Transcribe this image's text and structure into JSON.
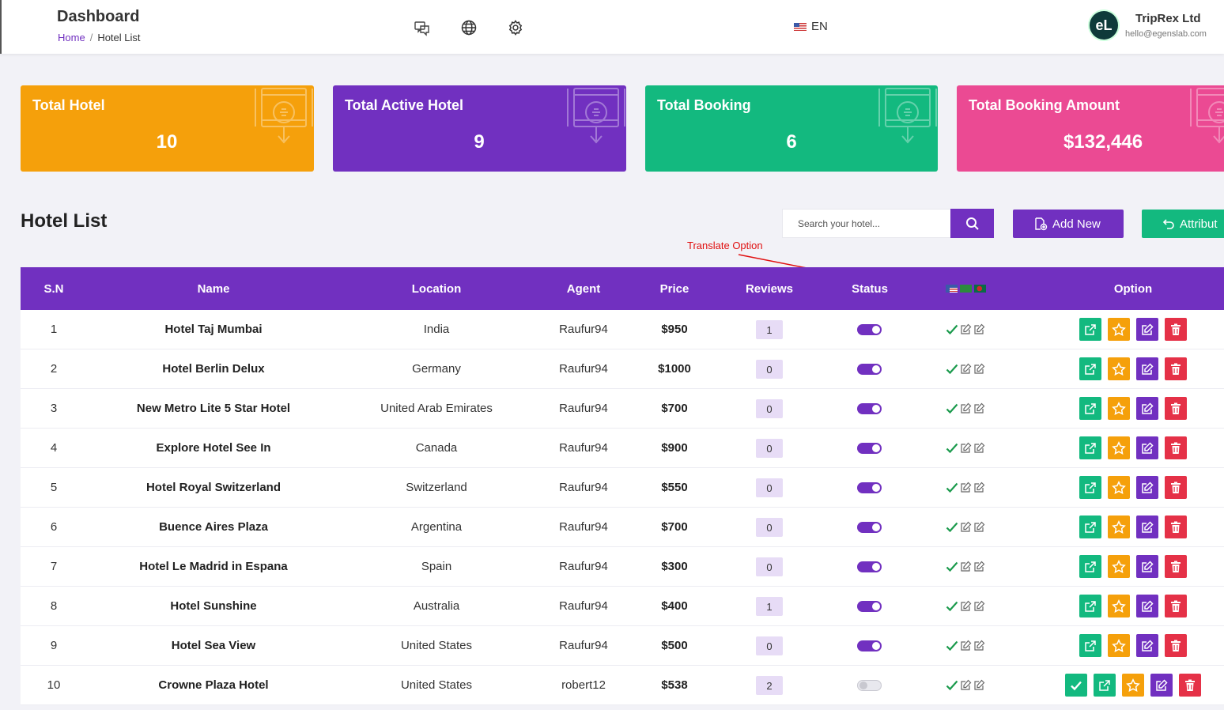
{
  "header": {
    "title": "Dashboard",
    "breadcrumb_home": "Home",
    "breadcrumb_sep": "/",
    "breadcrumb_current": "Hotel List",
    "language": "EN",
    "avatar_initials": "eL",
    "company": "TripRex Ltd",
    "email": "hello@egenslab.com"
  },
  "stats": [
    {
      "label": "Total Hotel",
      "value": "10",
      "color": "#f5a00b"
    },
    {
      "label": "Total Active Hotel",
      "value": "9",
      "color": "#7130c0"
    },
    {
      "label": "Total Booking",
      "value": "6",
      "color": "#13b97f"
    },
    {
      "label": "Total Booking Amount",
      "value": "$132,446",
      "color": "#eb4a93"
    }
  ],
  "list": {
    "title": "Hotel List",
    "search_placeholder": "Search your hotel...",
    "add_label": "Add New",
    "attr_label": "Attribut",
    "annotation": "Translate Option"
  },
  "table": {
    "columns": [
      "S.N",
      "Name",
      "Location",
      "Agent",
      "Price",
      "Reviews",
      "Status",
      "",
      "Option"
    ],
    "rows": [
      {
        "sn": "1",
        "name": "Hotel Taj Mumbai",
        "location": "India",
        "agent": "Raufur94",
        "price": "$950",
        "reviews": "1",
        "active": true,
        "approved": true
      },
      {
        "sn": "2",
        "name": "Hotel Berlin Delux",
        "location": "Germany",
        "agent": "Raufur94",
        "price": "$1000",
        "reviews": "0",
        "active": true,
        "approved": true
      },
      {
        "sn": "3",
        "name": "New Metro Lite 5 Star Hotel",
        "location": "United Arab Emirates",
        "agent": "Raufur94",
        "price": "$700",
        "reviews": "0",
        "active": true,
        "approved": true
      },
      {
        "sn": "4",
        "name": "Explore Hotel See In",
        "location": "Canada",
        "agent": "Raufur94",
        "price": "$900",
        "reviews": "0",
        "active": true,
        "approved": true
      },
      {
        "sn": "5",
        "name": "Hotel Royal Switzerland",
        "location": "Switzerland",
        "agent": "Raufur94",
        "price": "$550",
        "reviews": "0",
        "active": true,
        "approved": true
      },
      {
        "sn": "6",
        "name": "Buence Aires Plaza",
        "location": "Argentina",
        "agent": "Raufur94",
        "price": "$700",
        "reviews": "0",
        "active": true,
        "approved": true
      },
      {
        "sn": "7",
        "name": "Hotel Le Madrid in Espana",
        "location": "Spain",
        "agent": "Raufur94",
        "price": "$300",
        "reviews": "0",
        "active": true,
        "approved": true
      },
      {
        "sn": "8",
        "name": "Hotel Sunshine",
        "location": "Australia",
        "agent": "Raufur94",
        "price": "$400",
        "reviews": "1",
        "active": true,
        "approved": true
      },
      {
        "sn": "9",
        "name": "Hotel Sea View",
        "location": "United States",
        "agent": "Raufur94",
        "price": "$500",
        "reviews": "0",
        "active": true,
        "approved": true
      },
      {
        "sn": "10",
        "name": "Crowne Plaza Hotel",
        "location": "United States",
        "agent": "robert12",
        "price": "$538",
        "reviews": "2",
        "active": false,
        "approved": false
      }
    ]
  },
  "icons": {
    "header": [
      "chat-icon",
      "globe-icon",
      "gear-icon"
    ],
    "options": [
      "external-link-icon",
      "star-icon",
      "edit-icon",
      "trash-icon"
    ],
    "approve": "check-icon"
  }
}
